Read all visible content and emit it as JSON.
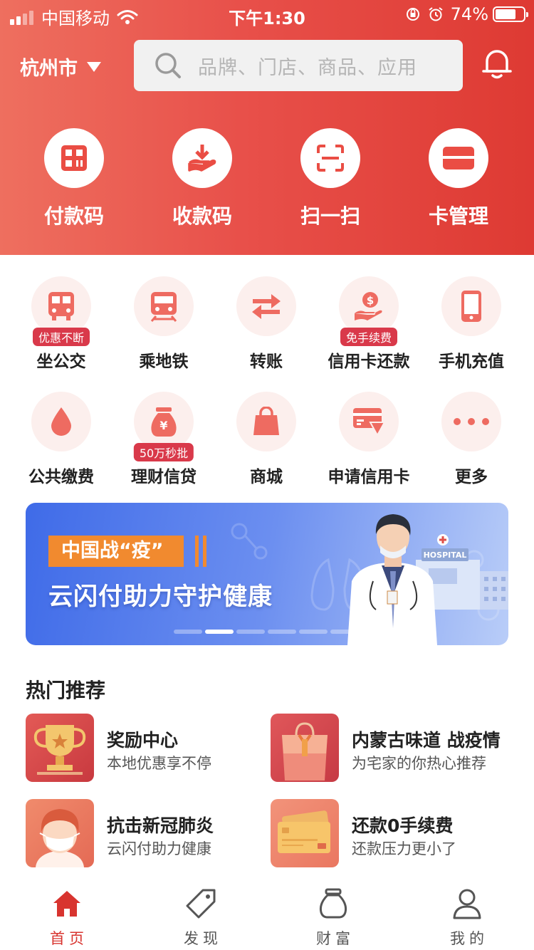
{
  "status_bar": {
    "carrier": "中国移动",
    "time": "下午1:30",
    "battery_percent": "74%",
    "battery_level": 0.74,
    "signal_bars_filled": 2
  },
  "header": {
    "city": "杭州市",
    "search_placeholder": "品牌、门店、商品、应用"
  },
  "quick_actions": [
    {
      "label": "付款码",
      "icon": "qr-pay-icon"
    },
    {
      "label": "收款码",
      "icon": "receive-money-icon"
    },
    {
      "label": "扫一扫",
      "icon": "scan-icon"
    },
    {
      "label": "卡管理",
      "icon": "card-icon"
    }
  ],
  "services": [
    {
      "label": "坐公交",
      "badge": "优惠不断",
      "icon": "bus-icon"
    },
    {
      "label": "乘地铁",
      "badge": "",
      "icon": "metro-icon"
    },
    {
      "label": "转账",
      "badge": "",
      "icon": "transfer-icon"
    },
    {
      "label": "信用卡还款",
      "badge": "免手续费",
      "icon": "credit-repay-icon"
    },
    {
      "label": "手机充值",
      "badge": "",
      "icon": "phone-icon"
    },
    {
      "label": "公共缴费",
      "badge": "",
      "icon": "water-drop-icon"
    },
    {
      "label": "理财信贷",
      "badge": "50万秒批",
      "icon": "money-bag-icon"
    },
    {
      "label": "商城",
      "badge": "",
      "icon": "shopping-bag-icon"
    },
    {
      "label": "申请信用卡",
      "badge": "",
      "icon": "card-apply-icon"
    },
    {
      "label": "更多",
      "badge": "",
      "icon": "more-icon"
    }
  ],
  "banner": {
    "tag": "中国战“疫”",
    "title": "云闪付助力守护健康",
    "art_text": "HOSPITAL",
    "page_count": 6,
    "active_page": 2
  },
  "hot": {
    "title": "热门推荐",
    "items": [
      {
        "title": "奖励中心",
        "subtitle": "本地优惠享不停"
      },
      {
        "title": "内蒙古味道 战疫情",
        "subtitle": "为宅家的你热心推荐"
      },
      {
        "title": "抗击新冠肺炎",
        "subtitle": "云闪付助力健康"
      },
      {
        "title": "还款0手续费",
        "subtitle": "还款压力更小了"
      }
    ]
  },
  "tabs": [
    {
      "label": "首页",
      "active": true
    },
    {
      "label": "发现",
      "active": false
    },
    {
      "label": "财富",
      "active": false
    },
    {
      "label": "我的",
      "active": false
    }
  ],
  "colors": {
    "brand_red": "#e8504a",
    "badge_red": "#d9394a",
    "icon_coral": "#ee6b61",
    "tab_active": "#d8342f",
    "banner_tag_orange": "#f18a2f"
  }
}
